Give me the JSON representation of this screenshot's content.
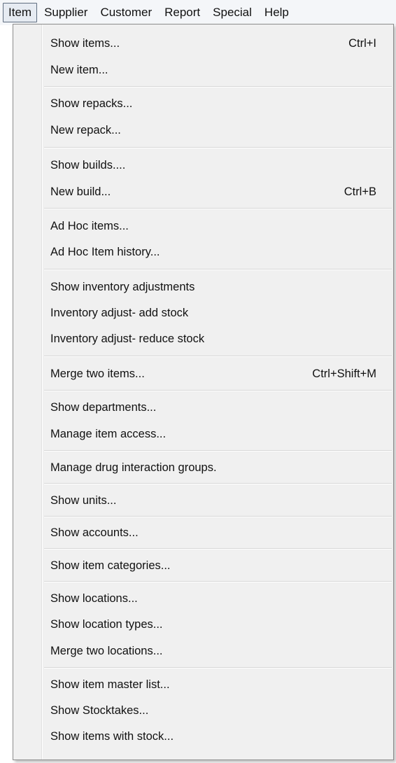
{
  "menubar": [
    {
      "label": "Item",
      "active": true
    },
    {
      "label": "Supplier"
    },
    {
      "label": "Customer"
    },
    {
      "label": "Report"
    },
    {
      "label": "Special"
    },
    {
      "label": "Help"
    }
  ],
  "menu": {
    "items": [
      {
        "label": "Show items...",
        "shortcut": "Ctrl+I"
      },
      {
        "label": "New item...",
        "shortcut": ""
      },
      {
        "label": "Show repacks...",
        "shortcut": ""
      },
      {
        "label": "New repack...",
        "shortcut": ""
      },
      {
        "label": "Show builds....",
        "shortcut": ""
      },
      {
        "label": "New build...",
        "shortcut": "Ctrl+B"
      },
      {
        "label": "Ad Hoc items...",
        "shortcut": ""
      },
      {
        "label": "Ad Hoc Item history...",
        "shortcut": ""
      },
      {
        "label": "Show inventory adjustments",
        "shortcut": ""
      },
      {
        "label": "Inventory adjust- add stock",
        "shortcut": ""
      },
      {
        "label": "Inventory adjust- reduce stock",
        "shortcut": ""
      },
      {
        "label": "Merge two items...",
        "shortcut": "Ctrl+Shift+M"
      },
      {
        "label": "Show departments...",
        "shortcut": ""
      },
      {
        "label": "Manage item access...",
        "shortcut": ""
      },
      {
        "label": "Manage drug interaction groups.",
        "shortcut": ""
      },
      {
        "label": "Show units...",
        "shortcut": ""
      },
      {
        "label": "Show accounts...",
        "shortcut": ""
      },
      {
        "label": "Show item categories...",
        "shortcut": ""
      },
      {
        "label": "Show locations...",
        "shortcut": ""
      },
      {
        "label": "Show location types...",
        "shortcut": ""
      },
      {
        "label": "Merge two locations...",
        "shortcut": ""
      },
      {
        "label": "Show item master list...",
        "shortcut": ""
      },
      {
        "label": "Show Stocktakes...",
        "shortcut": ""
      },
      {
        "label": "Show items with stock...",
        "shortcut": ""
      }
    ]
  }
}
